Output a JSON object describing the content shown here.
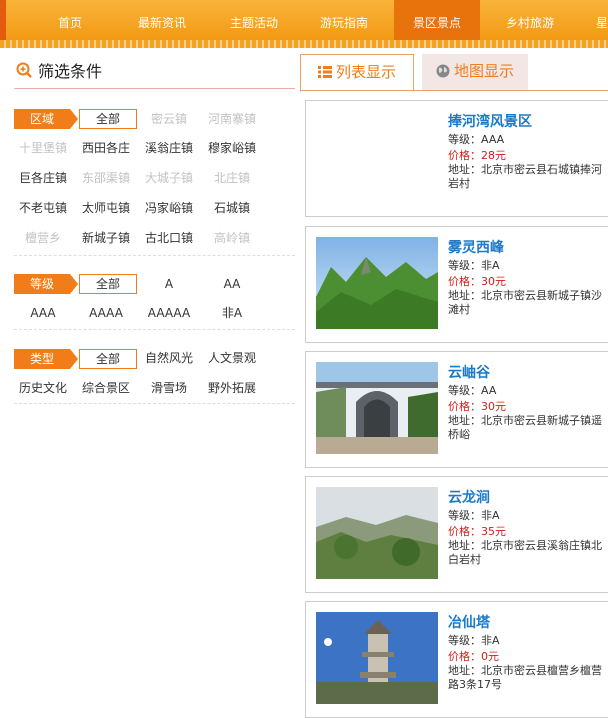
{
  "nav": {
    "items": [
      "首页",
      "最新资讯",
      "主题活动",
      "游玩指南",
      "景区景点",
      "乡村旅游",
      "星"
    ],
    "active_index": 4
  },
  "filter": {
    "title": "筛选条件",
    "region": {
      "tag": "区域",
      "all": "全部",
      "options": [
        {
          "label": "密云镇",
          "dim": true
        },
        {
          "label": "河南寨镇",
          "dim": true
        },
        {
          "label": "十里堡镇",
          "dim": true
        },
        {
          "label": "西田各庄",
          "dim": false
        },
        {
          "label": "溪翁庄镇",
          "dim": false
        },
        {
          "label": "穆家峪镇",
          "dim": false
        },
        {
          "label": "巨各庄镇",
          "dim": false
        },
        {
          "label": "东邵渠镇",
          "dim": true
        },
        {
          "label": "大城子镇",
          "dim": true
        },
        {
          "label": "北庄镇",
          "dim": true
        },
        {
          "label": "不老屯镇",
          "dim": false
        },
        {
          "label": "太师屯镇",
          "dim": false
        },
        {
          "label": "冯家峪镇",
          "dim": false
        },
        {
          "label": "石城镇",
          "dim": false
        },
        {
          "label": "檀营乡",
          "dim": true
        },
        {
          "label": "新城子镇",
          "dim": false
        },
        {
          "label": "古北口镇",
          "dim": false
        },
        {
          "label": "高岭镇",
          "dim": true
        }
      ]
    },
    "level": {
      "tag": "等级",
      "all": "全部",
      "options": [
        "A",
        "AA",
        "AAA",
        "AAAA",
        "AAAAA",
        "非A"
      ]
    },
    "type": {
      "tag": "类型",
      "all": "全部",
      "options": [
        "自然风光",
        "人文景观",
        "历史文化",
        "综合景区",
        "滑雪场",
        "野外拓展"
      ]
    }
  },
  "tabs": {
    "list": "列表显示",
    "map": "地图显示"
  },
  "spots": [
    {
      "name": "捧河湾风景区",
      "level": "等级：AAA",
      "price": "价格：28元",
      "address": "地址：北京市密云县石城镇捧河岩村",
      "has_image": false
    },
    {
      "name": "雾灵西峰",
      "level": "等级：非A",
      "price": "价格：30元",
      "address": "地址：北京市密云县新城子镇沙滩村",
      "has_image": true
    },
    {
      "name": "云岫谷",
      "level": "等级：AA",
      "price": "价格：30元",
      "address": "地址：北京市密云县新城子镇遥桥峪",
      "has_image": true
    },
    {
      "name": "云龙涧",
      "level": "等级：非A",
      "price": "价格：35元",
      "address": "地址：北京市密云县溪翁庄镇北白岩村",
      "has_image": true
    },
    {
      "name": "冶仙塔",
      "level": "等级：非A",
      "price": "价格：0元",
      "address": "地址：北京市密云县檀营乡檀营路3条17号",
      "has_image": true
    }
  ],
  "colors": {
    "accent": "#f07d1a",
    "link": "#1c79c8",
    "price": "#d2201a"
  }
}
